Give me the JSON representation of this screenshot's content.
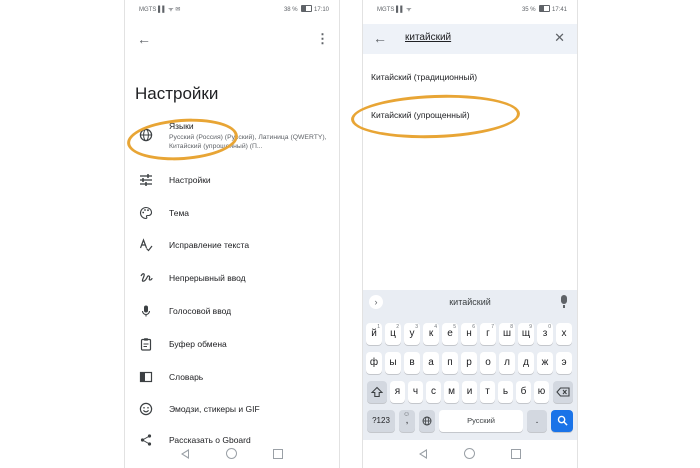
{
  "left_phone": {
    "status": {
      "left": "MGTS ▌▌ ᯤ ✉",
      "battery": "38 %",
      "time": "17:10"
    },
    "page_title": "Настройки",
    "languages": {
      "title": "Языки",
      "subtitle": "Русский (Россия) (Русский), Латиница (QWERTY), Китайский (упрощенный) (П..."
    },
    "menu": [
      {
        "label": "Настройки",
        "icon": "sliders-icon"
      },
      {
        "label": "Тема",
        "icon": "palette-icon"
      },
      {
        "label": "Исправление текста",
        "icon": "text-correction-icon"
      },
      {
        "label": "Непрерывный ввод",
        "icon": "gesture-icon"
      },
      {
        "label": "Голосовой ввод",
        "icon": "mic-icon"
      },
      {
        "label": "Буфер обмена",
        "icon": "clipboard-icon"
      },
      {
        "label": "Словарь",
        "icon": "book-icon"
      },
      {
        "label": "Эмодзи, стикеры и GIF",
        "icon": "emoji-icon"
      },
      {
        "label": "Рассказать о Gboard",
        "icon": "share-icon"
      }
    ]
  },
  "right_phone": {
    "status": {
      "left": "MGTS ▌▌ ᯤ",
      "battery": "35 %",
      "time": "17:41"
    },
    "search_query": "китайский",
    "results": [
      "Китайский (традиционный)",
      "Китайский (упрощенный)"
    ],
    "keyboard": {
      "suggestion": "китайский",
      "row1": [
        "й",
        "ц",
        "у",
        "к",
        "е",
        "н",
        "г",
        "ш",
        "щ",
        "з",
        "х"
      ],
      "row1_nums": [
        "1",
        "2",
        "3",
        "4",
        "5",
        "6",
        "7",
        "8",
        "9",
        "0",
        ""
      ],
      "row2": [
        "ф",
        "ы",
        "в",
        "а",
        "п",
        "р",
        "о",
        "л",
        "д",
        "ж",
        "э"
      ],
      "row3": [
        "я",
        "ч",
        "с",
        "м",
        "и",
        "т",
        "ь",
        "б",
        "ю"
      ],
      "symbols": "?123",
      "comma": ",",
      "space": "Русский",
      "period": "."
    }
  },
  "colors": {
    "highlight": "#e8a535",
    "accent": "#1a73e8",
    "keyboard_bg": "#e9edf3"
  }
}
